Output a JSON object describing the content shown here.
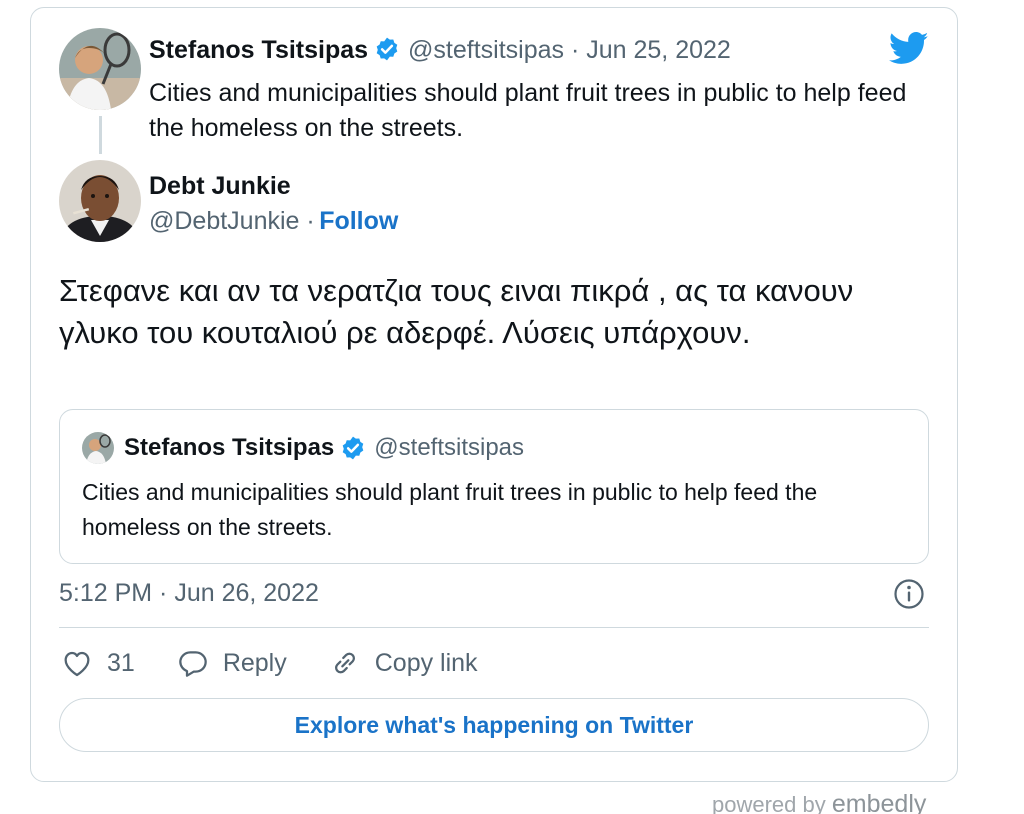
{
  "parent": {
    "name": "Stefanos Tsitsipas",
    "handle_date": "@steftsitsipas · Jun 25, 2022",
    "text": "Cities and municipalities should plant fruit trees in public to help feed the homeless on the streets."
  },
  "reply": {
    "name": "Debt Junkie",
    "handle": "@DebtJunkie ·",
    "follow_label": "Follow",
    "text": "Στεφανε και αν τα νερατζια τους ειναι πικρά , ας τα κανουν γλυκο του κουταλιού ρε αδερφέ. Λύσεις υπάρχουν."
  },
  "quote": {
    "name": "Stefanos Tsitsipas",
    "handle": "@steftsitsipas",
    "text": "Cities and municipalities should plant fruit trees in public to help feed the homeless on the streets."
  },
  "timestamp": "5:12 PM · Jun 26, 2022",
  "actions": {
    "likes": "31",
    "reply_label": "Reply",
    "copy_label": "Copy link"
  },
  "explore_label": "Explore what's happening on Twitter",
  "footer": {
    "powered_by": "powered by",
    "brand": "embedly"
  },
  "colors": {
    "accent": "#1d9bf0",
    "link": "#1a73c8",
    "muted": "#536471",
    "border": "#cfd9de"
  },
  "icons": [
    "verified-badge-icon",
    "twitter-bird-icon",
    "info-icon",
    "heart-icon",
    "reply-bubble-icon",
    "link-icon"
  ]
}
